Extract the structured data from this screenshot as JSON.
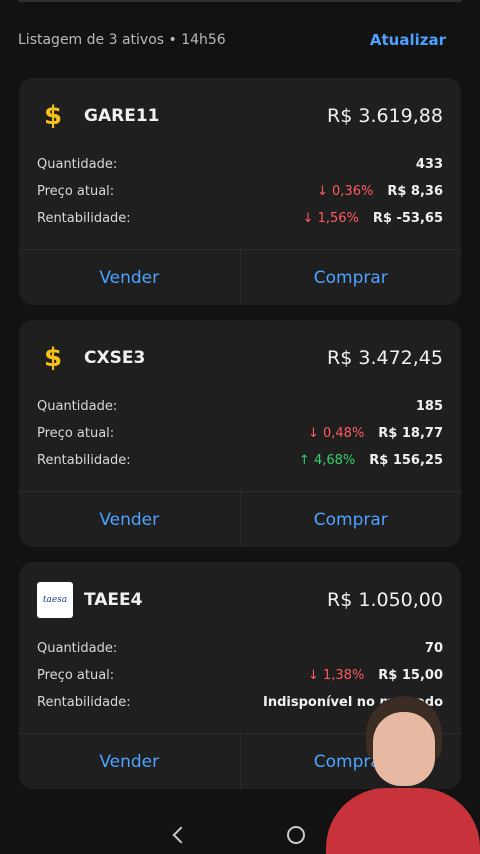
{
  "header": {
    "subtitle": "Listagem de 3 ativos • 14h56",
    "refresh_label": "Atualizar"
  },
  "labels": {
    "quantity": "Quantidade:",
    "price": "Preço atual:",
    "return": "Rentabilidade:"
  },
  "assets": [
    {
      "icon": "dollar-icon",
      "ticker": "GARE11",
      "total": "R$ 3.619,88",
      "quantity": "433",
      "price_change": "↓ 0,36%",
      "price": "R$ 8,36",
      "return_change": "↓ 1,56%",
      "return_value": "R$ -53,65",
      "sell_label": "Vender",
      "buy_label": "Comprar"
    },
    {
      "icon": "dollar-icon",
      "ticker": "CXSE3",
      "total": "R$ 3.472,45",
      "quantity": "185",
      "price_change": "↓ 0,48%",
      "price": "R$ 18,77",
      "return_change": "↑ 4,68%",
      "return_value": "R$ 156,25",
      "sell_label": "Vender",
      "buy_label": "Comprar"
    },
    {
      "icon": "taesa-logo",
      "logo_text": "taesa",
      "ticker": "TAEE4",
      "total": "R$ 1.050,00",
      "quantity": "70",
      "price_change": "↓ 1,38%",
      "price": "R$ 15,00",
      "return_text": "Indisponível no mercado",
      "sell_label": "Vender",
      "buy_label": "Comprar"
    }
  ],
  "colors": {
    "accent": "#4da3ff",
    "negative": "#ff5a5f",
    "positive": "#34d06b",
    "dollar": "#f6c019"
  }
}
